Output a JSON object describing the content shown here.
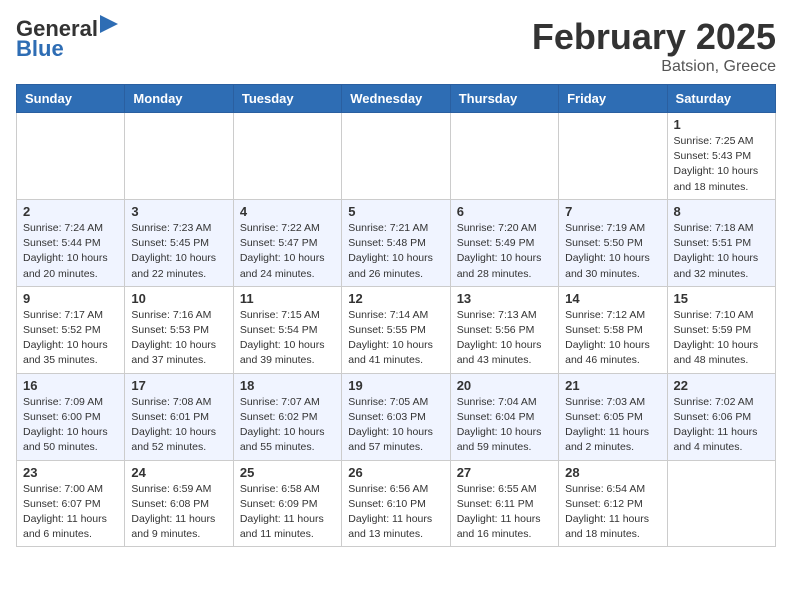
{
  "header": {
    "logo_general": "General",
    "logo_blue": "Blue",
    "month_year": "February 2025",
    "location": "Batsion, Greece"
  },
  "days_of_week": [
    "Sunday",
    "Monday",
    "Tuesday",
    "Wednesday",
    "Thursday",
    "Friday",
    "Saturday"
  ],
  "weeks": [
    [
      {
        "day": "",
        "info": ""
      },
      {
        "day": "",
        "info": ""
      },
      {
        "day": "",
        "info": ""
      },
      {
        "day": "",
        "info": ""
      },
      {
        "day": "",
        "info": ""
      },
      {
        "day": "",
        "info": ""
      },
      {
        "day": "1",
        "info": "Sunrise: 7:25 AM\nSunset: 5:43 PM\nDaylight: 10 hours\nand 18 minutes."
      }
    ],
    [
      {
        "day": "2",
        "info": "Sunrise: 7:24 AM\nSunset: 5:44 PM\nDaylight: 10 hours\nand 20 minutes."
      },
      {
        "day": "3",
        "info": "Sunrise: 7:23 AM\nSunset: 5:45 PM\nDaylight: 10 hours\nand 22 minutes."
      },
      {
        "day": "4",
        "info": "Sunrise: 7:22 AM\nSunset: 5:47 PM\nDaylight: 10 hours\nand 24 minutes."
      },
      {
        "day": "5",
        "info": "Sunrise: 7:21 AM\nSunset: 5:48 PM\nDaylight: 10 hours\nand 26 minutes."
      },
      {
        "day": "6",
        "info": "Sunrise: 7:20 AM\nSunset: 5:49 PM\nDaylight: 10 hours\nand 28 minutes."
      },
      {
        "day": "7",
        "info": "Sunrise: 7:19 AM\nSunset: 5:50 PM\nDaylight: 10 hours\nand 30 minutes."
      },
      {
        "day": "8",
        "info": "Sunrise: 7:18 AM\nSunset: 5:51 PM\nDaylight: 10 hours\nand 32 minutes."
      }
    ],
    [
      {
        "day": "9",
        "info": "Sunrise: 7:17 AM\nSunset: 5:52 PM\nDaylight: 10 hours\nand 35 minutes."
      },
      {
        "day": "10",
        "info": "Sunrise: 7:16 AM\nSunset: 5:53 PM\nDaylight: 10 hours\nand 37 minutes."
      },
      {
        "day": "11",
        "info": "Sunrise: 7:15 AM\nSunset: 5:54 PM\nDaylight: 10 hours\nand 39 minutes."
      },
      {
        "day": "12",
        "info": "Sunrise: 7:14 AM\nSunset: 5:55 PM\nDaylight: 10 hours\nand 41 minutes."
      },
      {
        "day": "13",
        "info": "Sunrise: 7:13 AM\nSunset: 5:56 PM\nDaylight: 10 hours\nand 43 minutes."
      },
      {
        "day": "14",
        "info": "Sunrise: 7:12 AM\nSunset: 5:58 PM\nDaylight: 10 hours\nand 46 minutes."
      },
      {
        "day": "15",
        "info": "Sunrise: 7:10 AM\nSunset: 5:59 PM\nDaylight: 10 hours\nand 48 minutes."
      }
    ],
    [
      {
        "day": "16",
        "info": "Sunrise: 7:09 AM\nSunset: 6:00 PM\nDaylight: 10 hours\nand 50 minutes."
      },
      {
        "day": "17",
        "info": "Sunrise: 7:08 AM\nSunset: 6:01 PM\nDaylight: 10 hours\nand 52 minutes."
      },
      {
        "day": "18",
        "info": "Sunrise: 7:07 AM\nSunset: 6:02 PM\nDaylight: 10 hours\nand 55 minutes."
      },
      {
        "day": "19",
        "info": "Sunrise: 7:05 AM\nSunset: 6:03 PM\nDaylight: 10 hours\nand 57 minutes."
      },
      {
        "day": "20",
        "info": "Sunrise: 7:04 AM\nSunset: 6:04 PM\nDaylight: 10 hours\nand 59 minutes."
      },
      {
        "day": "21",
        "info": "Sunrise: 7:03 AM\nSunset: 6:05 PM\nDaylight: 11 hours\nand 2 minutes."
      },
      {
        "day": "22",
        "info": "Sunrise: 7:02 AM\nSunset: 6:06 PM\nDaylight: 11 hours\nand 4 minutes."
      }
    ],
    [
      {
        "day": "23",
        "info": "Sunrise: 7:00 AM\nSunset: 6:07 PM\nDaylight: 11 hours\nand 6 minutes."
      },
      {
        "day": "24",
        "info": "Sunrise: 6:59 AM\nSunset: 6:08 PM\nDaylight: 11 hours\nand 9 minutes."
      },
      {
        "day": "25",
        "info": "Sunrise: 6:58 AM\nSunset: 6:09 PM\nDaylight: 11 hours\nand 11 minutes."
      },
      {
        "day": "26",
        "info": "Sunrise: 6:56 AM\nSunset: 6:10 PM\nDaylight: 11 hours\nand 13 minutes."
      },
      {
        "day": "27",
        "info": "Sunrise: 6:55 AM\nSunset: 6:11 PM\nDaylight: 11 hours\nand 16 minutes."
      },
      {
        "day": "28",
        "info": "Sunrise: 6:54 AM\nSunset: 6:12 PM\nDaylight: 11 hours\nand 18 minutes."
      },
      {
        "day": "",
        "info": ""
      }
    ]
  ]
}
